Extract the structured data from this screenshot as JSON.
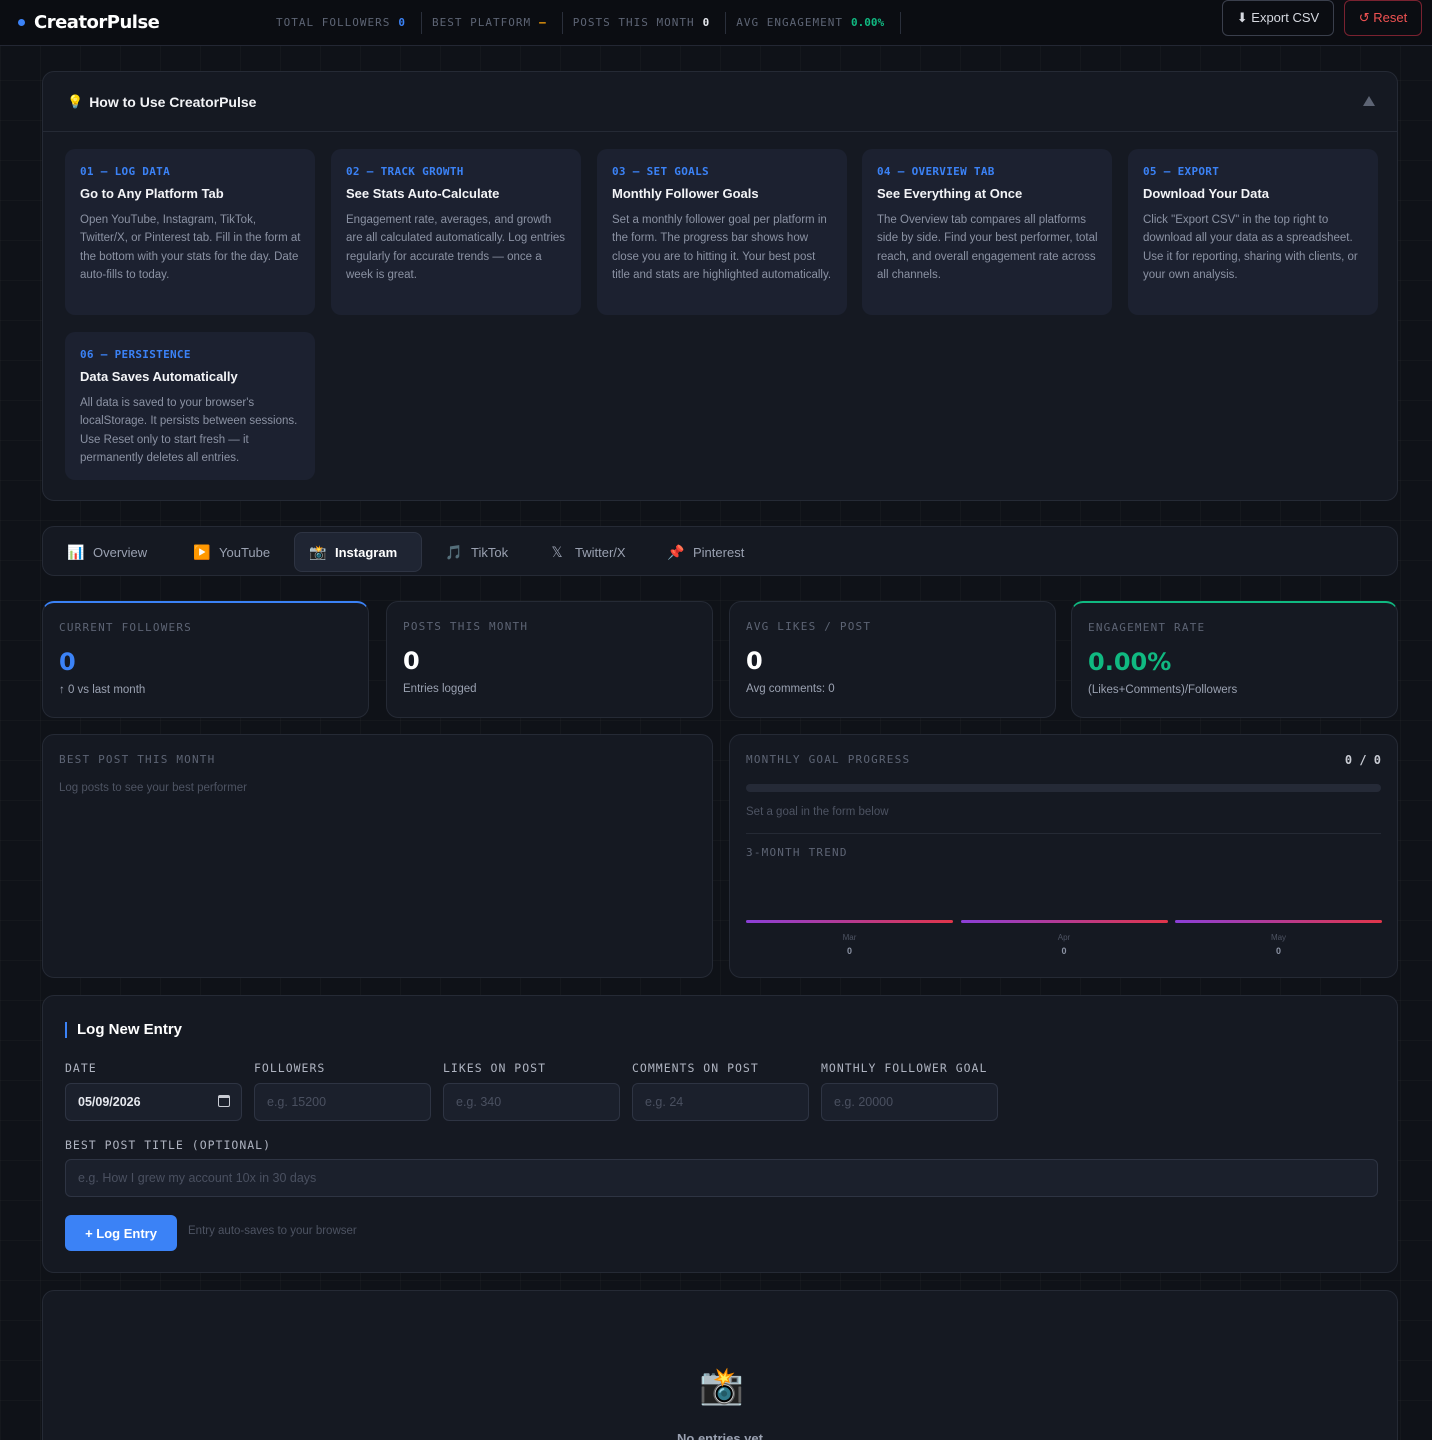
{
  "app": {
    "name": "CreatorPulse"
  },
  "header": {
    "stats": [
      {
        "label": "TOTAL FOLLOWERS",
        "value": "0",
        "color": "#3b82f6"
      },
      {
        "label": "BEST PLATFORM",
        "value": "—",
        "color": "#f59e0b"
      },
      {
        "label": "POSTS THIS MONTH",
        "value": "0",
        "color": "#e6e8ee"
      },
      {
        "label": "AVG ENGAGEMENT",
        "value": "0.00%",
        "color": "#10b981"
      }
    ],
    "export_label": "⬇ Export CSV",
    "reset_label": "↺ Reset"
  },
  "howto": {
    "icon": "lightbulb-icon",
    "title": "How to Use CreatorPulse",
    "cards": [
      {
        "step": "01 — LOG DATA",
        "title": "Go to Any Platform Tab",
        "text": "Open YouTube, Instagram, TikTok, Twitter/X, or Pinterest tab. Fill in the form at the bottom with your stats for the day. Date auto-fills to today."
      },
      {
        "step": "02 — TRACK GROWTH",
        "title": "See Stats Auto-Calculate",
        "text": "Engagement rate, averages, and growth are all calculated automatically. Log entries regularly for accurate trends — once a week is great."
      },
      {
        "step": "03 — SET GOALS",
        "title": "Monthly Follower Goals",
        "text": "Set a monthly follower goal per platform in the form. The progress bar shows how close you are to hitting it. Your best post title and stats are highlighted automatically."
      },
      {
        "step": "04 — OVERVIEW TAB",
        "title": "See Everything at Once",
        "text": "The Overview tab compares all platforms side by side. Find your best performer, total reach, and overall engagement rate across all channels."
      },
      {
        "step": "05 — EXPORT",
        "title": "Download Your Data",
        "text": "Click \"Export CSV\" in the top right to download all your data as a spreadsheet. Use it for reporting, sharing with clients, or your own analysis."
      },
      {
        "step": "06 — PERSISTENCE",
        "title": "Data Saves Automatically",
        "text": "All data is saved to your browser's localStorage. It persists between sessions. Use Reset only to start fresh — it permanently deletes all entries."
      }
    ]
  },
  "tabs": [
    {
      "label": "Overview",
      "icon": "📊",
      "active": false
    },
    {
      "label": "YouTube",
      "icon": "▶️",
      "active": false
    },
    {
      "label": "Instagram",
      "icon": "📸",
      "active": true
    },
    {
      "label": "TikTok",
      "icon": "🎵",
      "active": false
    },
    {
      "label": "Twitter/X",
      "icon": "𝕏",
      "active": false
    },
    {
      "label": "Pinterest",
      "icon": "📌",
      "active": false
    }
  ],
  "stat_cards": [
    {
      "label": "CURRENT FOLLOWERS",
      "value": "0",
      "sub": "↑ 0 vs last month",
      "color": "#3b82f6"
    },
    {
      "label": "POSTS THIS MONTH",
      "value": "0",
      "sub": "Entries logged",
      "color": "#ffffff"
    },
    {
      "label": "AVG LIKES / POST",
      "value": "0",
      "sub": "Avg comments: 0",
      "color": "#ffffff"
    },
    {
      "label": "ENGAGEMENT RATE",
      "value": "0.00%",
      "sub": "(Likes+Comments)/Followers",
      "color": "#10b981"
    }
  ],
  "best_post": {
    "label": "BEST POST THIS MONTH",
    "empty": "Log posts to see your best performer"
  },
  "goal": {
    "label": "MONTHLY GOAL PROGRESS",
    "count": "0 / 0",
    "progress": 0,
    "hint": "Set a goal in the form below",
    "trend_label": "3-MONTH TREND",
    "trend": [
      {
        "month": "Mar",
        "value": "0"
      },
      {
        "month": "Apr",
        "value": "0"
      },
      {
        "month": "May",
        "value": "0"
      }
    ]
  },
  "form": {
    "title": "Log New Entry",
    "date_label": "DATE",
    "date_value": "05/09/2026",
    "followers_label": "FOLLOWERS",
    "followers_placeholder": "e.g. 15200",
    "likes_label": "LIKES ON POST",
    "likes_placeholder": "e.g. 340",
    "comments_label": "COMMENTS ON POST",
    "comments_placeholder": "e.g. 24",
    "goal_label": "MONTHLY FOLLOWER GOAL",
    "goal_placeholder": "e.g. 20000",
    "title_label": "BEST POST TITLE (OPTIONAL)",
    "title_placeholder": "e.g. How I grew my account 10x in 30 days",
    "submit_label": "+ Log Entry",
    "autosave_note": "Entry auto-saves to your browser"
  },
  "empty_state": {
    "icon": "📸",
    "text": "No entries yet"
  }
}
